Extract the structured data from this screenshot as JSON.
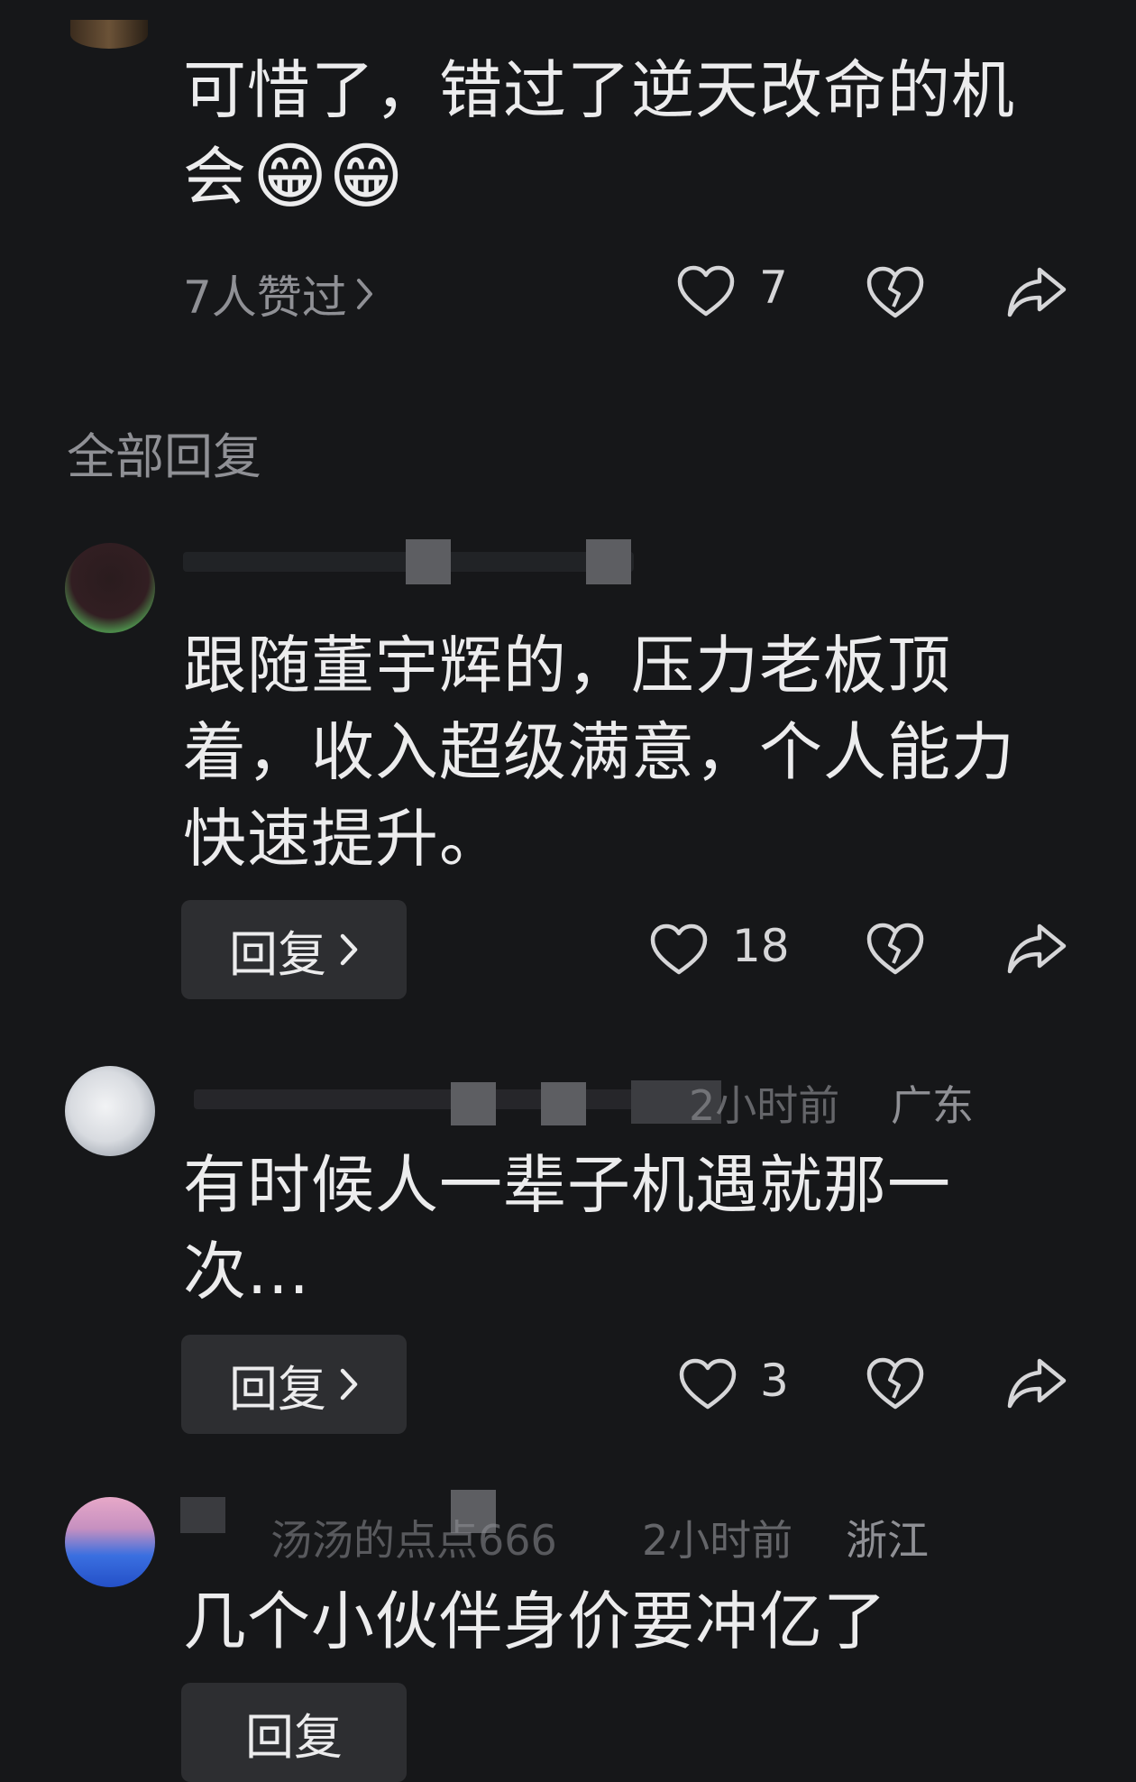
{
  "post": {
    "text_line1": "可惜了，错过了逆天改命的机",
    "text_line2": "会",
    "emoji": "😁😁",
    "likes_summary": "7人赞过",
    "like_count": "7"
  },
  "section_title": "全部回复",
  "comments": [
    {
      "meta": "",
      "text_lines": [
        "跟随董宇辉的，压力老板顶",
        "着，收入超级满意，个人能力",
        "快速提升。"
      ],
      "reply_label": "回复",
      "like_count": "18"
    },
    {
      "meta_time": "2小时前",
      "meta_region": "广东",
      "text_lines": [
        "有时候人一辈子机遇就那一",
        "次..."
      ],
      "reply_label": "回复",
      "like_count": "3"
    },
    {
      "meta_name": "汤汤的点点666",
      "meta_time": "2小时前",
      "meta_region": "浙江",
      "text_lines": [
        "几个小伙伴身价要冲亿了"
      ],
      "reply_label": "回复",
      "like_count": ""
    }
  ],
  "icons": {
    "like": "heart-icon",
    "dislike": "broken-heart-icon",
    "share": "share-arrow-icon",
    "more": "chevron-right-icon"
  }
}
